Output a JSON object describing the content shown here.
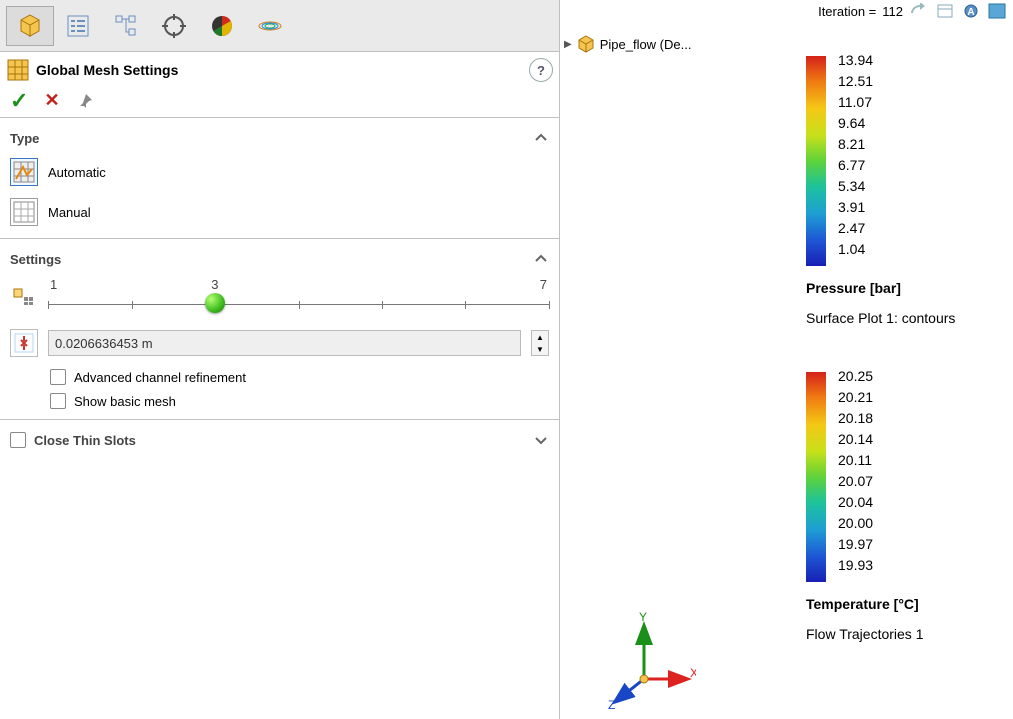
{
  "tabs": {
    "active_index": 0
  },
  "panel": {
    "title": "Global Mesh Settings",
    "type_label": "Type",
    "type_options": {
      "automatic": "Automatic",
      "manual": "Manual"
    },
    "settings_label": "Settings",
    "slider": {
      "min_label": "1",
      "mid_label": "3",
      "max_label": "7",
      "value": 3,
      "max": 7
    },
    "cell_size": "0.0206636453 m",
    "adv_refine_label": "Advanced channel refinement",
    "show_mesh_label": "Show basic mesh",
    "close_slots_label": "Close Thin Slots"
  },
  "project_tree": {
    "root_label": "Pipe_flow (De..."
  },
  "iteration": {
    "label": "Iteration =",
    "value": "112"
  },
  "legends": {
    "pressure": {
      "title": "Pressure [bar]",
      "subtitle": "Surface Plot 1: contours",
      "values": [
        "13.94",
        "12.51",
        "11.07",
        "9.64",
        "8.21",
        "6.77",
        "5.34",
        "3.91",
        "2.47",
        "1.04"
      ]
    },
    "temperature": {
      "title": "Temperature [°C]",
      "subtitle": "Flow Trajectories 1",
      "values": [
        "20.25",
        "20.21",
        "20.18",
        "20.14",
        "20.11",
        "20.07",
        "20.04",
        "20.00",
        "19.97",
        "19.93"
      ]
    }
  },
  "axes": {
    "x": "X",
    "y": "Y",
    "z": "Z"
  },
  "chart_data": [
    {
      "type": "colorbar",
      "title": "Pressure [bar]",
      "values": [
        13.94,
        12.51,
        11.07,
        9.64,
        8.21,
        6.77,
        5.34,
        3.91,
        2.47,
        1.04
      ],
      "colormap": "rainbow",
      "range": [
        1.04,
        13.94
      ]
    },
    {
      "type": "colorbar",
      "title": "Temperature [°C]",
      "values": [
        20.25,
        20.21,
        20.18,
        20.14,
        20.11,
        20.07,
        20.04,
        20.0,
        19.97,
        19.93
      ],
      "colormap": "rainbow",
      "range": [
        19.93,
        20.25
      ]
    }
  ]
}
